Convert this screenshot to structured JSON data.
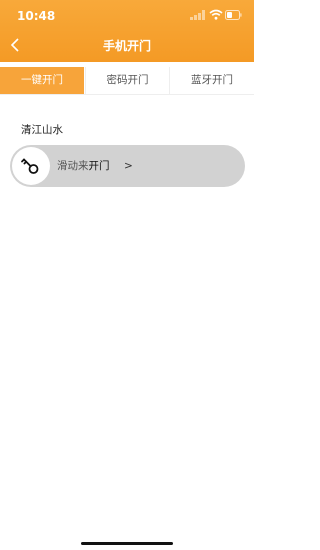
{
  "status_bar": {
    "time": "10:48"
  },
  "nav": {
    "title": "手机开门"
  },
  "tabs": [
    {
      "label": "一键开门",
      "active": true
    },
    {
      "label": "密码开门",
      "active": false
    },
    {
      "label": "蓝牙开门",
      "active": false
    }
  ],
  "door": {
    "name": "清江山水"
  },
  "slider": {
    "hint_prefix": "滑动来",
    "hint_action": "开门",
    "arrow": ">",
    "icon": "key-icon"
  },
  "colors": {
    "accent": "#f7a43a",
    "track": "#d2d2d2"
  }
}
